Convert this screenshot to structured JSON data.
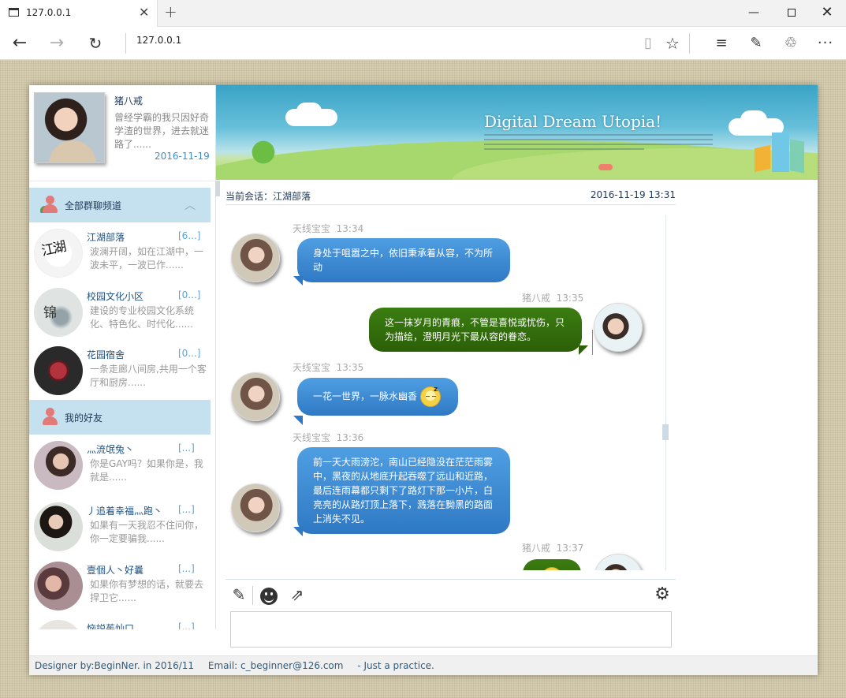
{
  "browser": {
    "tab_title": "127.0.0.1",
    "address": "127.0.0.1"
  },
  "icons": {
    "back": "back-arrow-icon",
    "forward": "forward-arrow-icon",
    "refresh": "refresh-icon",
    "reading_view": "reading-view-icon",
    "favorite": "star-icon",
    "hub": "hub-icon",
    "web_note": "web-note-icon",
    "share": "share-icon",
    "more": "more-icon",
    "edit": "edit-icon",
    "emoji": "emoji-icon",
    "export": "export-icon",
    "settings": "gear-icon"
  },
  "profile": {
    "name": "猪八戒",
    "motto": "曾经学霸的我只因好奇学渣的世界，进去就迷路了......",
    "date": "2016-11-19"
  },
  "groups_section": {
    "label": "全部群聊频道",
    "items": [
      {
        "name": "江湖部落",
        "count": "[6...]",
        "preview": "波澜开阔，如在江湖中，一波未平，一波已作......",
        "avatar_text": "江湖"
      },
      {
        "name": "校园文化小区",
        "count": "[0...]",
        "preview": "建设的专业校园文化系统化、特色化、时代化......",
        "avatar_text": "锦"
      },
      {
        "name": "花园宿舍",
        "count": "[0...]",
        "preview": "一条走廊八间房,共用一个客厅和厨房......",
        "avatar_text": ""
      }
    ]
  },
  "friends_section": {
    "label": "我的好友",
    "items": [
      {
        "name": "灬流氓兔丶",
        "count": "[...]",
        "preview": "你是GAY吗？如果你是，我就是......"
      },
      {
        "name": "丿追着幸福灬跑丶",
        "count": "[...]",
        "preview": "如果有一天我忍不住问你，你一定要骗我......"
      },
      {
        "name": "壹個人丶好曩",
        "count": "[...]",
        "preview": "如果你有梦想的话，就要去捍卫它......"
      },
      {
        "name": "恼説茱灿口",
        "count": "[...]",
        "preview": ""
      }
    ]
  },
  "banner": {
    "title": "Digital Dream Utopia!"
  },
  "chat": {
    "header_label": "当前会话：江湖部落",
    "header_time": "2016-11-19 13:31",
    "messages": [
      {
        "sender": "天线宝宝",
        "time": "13:34",
        "text": "身处于咀嚣之中，依旧秉承着从容，不为所动"
      },
      {
        "sender": "猪八戒",
        "time": "13:35",
        "text": "这一抹岁月的青痕，不管是喜悦或忧伤，只为描绘，澄明月光下最从容的眷恋。"
      },
      {
        "sender": "天线宝宝",
        "time": "13:35",
        "text": "一花一世界，一脉水幽香"
      },
      {
        "sender": "天线宝宝",
        "time": "13:36",
        "text": "前一天大雨滂沱，南山已经隐没在茫茫雨雾中，黑夜的从地底升起吞噬了远山和近路，最后连雨幕都只剩下了路灯下那一小片，白亮亮的从路灯顶上落下，溅落在黝黑的路面上消失不见。"
      },
      {
        "sender": "猪八戒",
        "time": "13:37",
        "text": ""
      }
    ],
    "input_placeholder": ""
  },
  "footer": {
    "designer": "Designer by:BeginNer.  in 2016/11",
    "email": "Email: c_beginner@126.com",
    "note": "- Just a practice."
  }
}
